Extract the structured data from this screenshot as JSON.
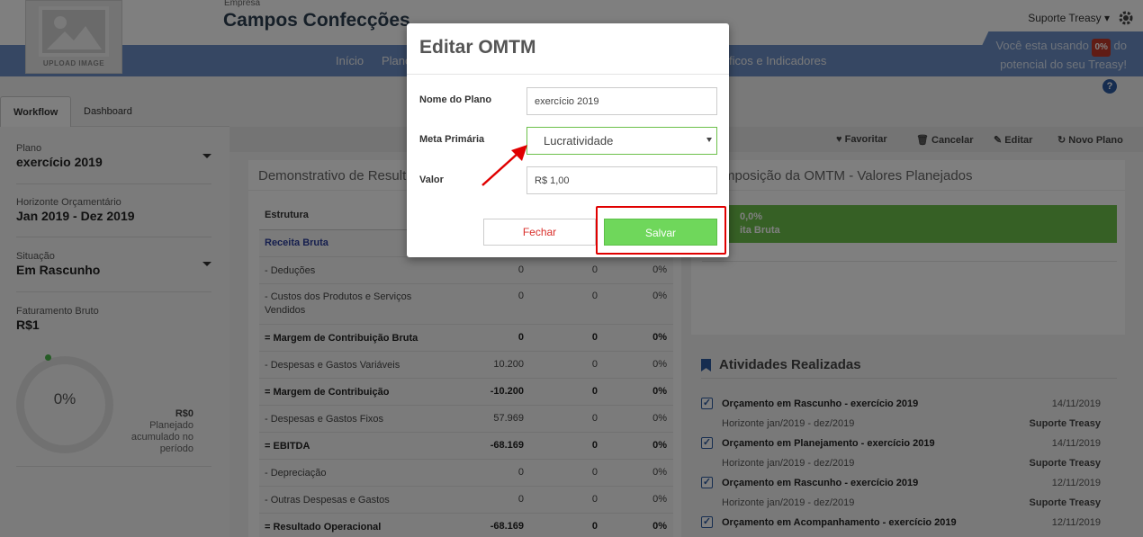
{
  "header": {
    "logo_caption": "UPLOAD IMAGE",
    "empresa_label": "Empresa",
    "empresa_name": "Campos Confecções",
    "nav": [
      "Início",
      "Plano",
      "ficos e Indicadores"
    ],
    "user": "Suporte Treasy",
    "usage_prefix": "Você esta usando",
    "usage_pct": "0%",
    "usage_mid": "do",
    "usage_suffix": "potencial do seu Treasy!",
    "help": "?"
  },
  "tabs": [
    "Workflow",
    "Dashboard"
  ],
  "sidebar": {
    "plano_label": "Plano",
    "plano_value": "exercício 2019",
    "horizonte_label": "Horizonte Orçamentário",
    "horizonte_value": "Jan 2019 - Dez 2019",
    "situacao_label": "Situação",
    "situacao_value": "Em Rascunho",
    "faturamento_label": "Faturamento Bruto",
    "faturamento_value": "R$1",
    "donut_pct": "0%",
    "sum_value": "R$0",
    "sum_caption": "Planejado acumulado no período"
  },
  "toolbar": {
    "favoritar": "Favoritar",
    "cancelar": "Cancelar",
    "editar": "Editar",
    "novo_plano": "Novo Plano"
  },
  "left_panel": {
    "title": "Demonstrativo de Result",
    "column_header": "Estrutura",
    "rows": [
      {
        "label": "Receita Bruta",
        "v1": "",
        "v2": "",
        "v3": ""
      },
      {
        "label": "- Deduções",
        "v1": "0",
        "v2": "0",
        "v3": "0%"
      },
      {
        "label": "- Custos dos Produtos e Serviços Vendidos",
        "v1": "0",
        "v2": "0",
        "v3": "0%"
      },
      {
        "label": "= Margem de Contribuição Bruta",
        "v1": "0",
        "v2": "0",
        "v3": "0%"
      },
      {
        "label": "- Despesas e Gastos Variáveis",
        "v1": "10.200",
        "v2": "0",
        "v3": "0%"
      },
      {
        "label": "= Margem de Contribuição",
        "v1": "-10.200",
        "v2": "0",
        "v3": "0%"
      },
      {
        "label": "- Despesas e Gastos Fixos",
        "v1": "57.969",
        "v2": "0",
        "v3": "0%"
      },
      {
        "label": "= EBITDA",
        "v1": "-68.169",
        "v2": "0",
        "v3": "0%"
      },
      {
        "label": "- Depreciação",
        "v1": "0",
        "v2": "0",
        "v3": "0%"
      },
      {
        "label": "- Outras Despesas e Gastos",
        "v1": "0",
        "v2": "0",
        "v3": "0%"
      },
      {
        "label": "= Resultado Operacional",
        "v1": "-68.169",
        "v2": "0",
        "v3": "0%"
      }
    ]
  },
  "right_panel": {
    "title": "mposição da OMTM - Valores Planejados",
    "bar_pct": "0,0%",
    "bar_label": "ita Bruta"
  },
  "activities": {
    "title": "Atividades Realizadas",
    "items": [
      {
        "title": "Orçamento em Rascunho - exercício 2019",
        "date": "14/11/2019",
        "horizon": "Horizonte jan/2019 - dez/2019",
        "user": "Suporte Treasy"
      },
      {
        "title": "Orçamento em Planejamento - exercício 2019",
        "date": "14/11/2019",
        "horizon": "Horizonte jan/2019 - dez/2019",
        "user": "Suporte Treasy"
      },
      {
        "title": "Orçamento em Rascunho - exercício 2019",
        "date": "12/11/2019",
        "horizon": "Horizonte jan/2019 - dez/2019",
        "user": "Suporte Treasy"
      },
      {
        "title": "Orçamento em Acompanhamento - exercício 2019",
        "date": "12/11/2019",
        "horizon": "",
        "user": ""
      }
    ]
  },
  "modal": {
    "title": "Editar OMTM",
    "nome_label": "Nome do Plano",
    "nome_value": "exercício 2019",
    "meta_label": "Meta Primária",
    "meta_value": "Lucratividade",
    "valor_label": "Valor",
    "valor_value": "R$ 1,00",
    "fechar": "Fechar",
    "salvar": "Salvar"
  },
  "colors": {
    "header_band": "#6d8fc7",
    "accent_green": "#6cc04a",
    "highlight_red": "#e00000",
    "link_blue": "#2a3d9c"
  }
}
